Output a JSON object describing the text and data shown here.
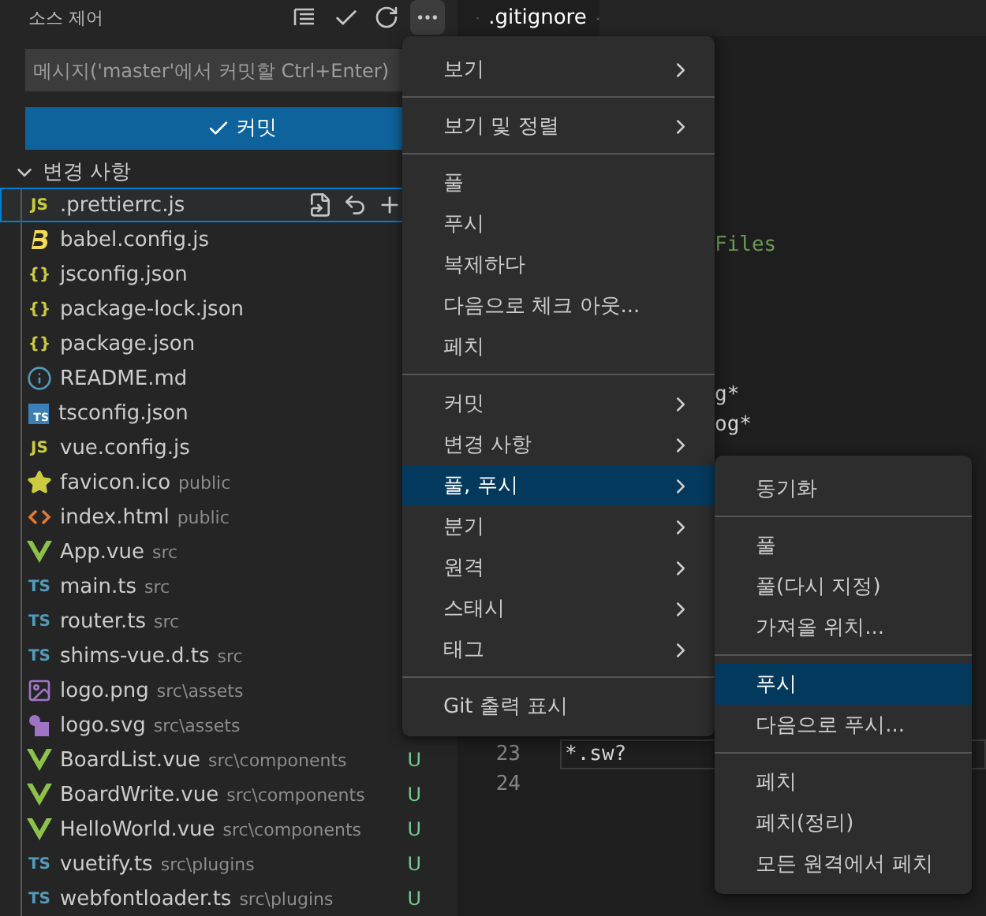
{
  "sidebar": {
    "title": "소스 제어",
    "commit_input": {
      "placeholder": "메시지('master'에서 커밋할 Ctrl+Enter)"
    },
    "commit_button": "커밋",
    "changes_header": "변경 사항",
    "files": [
      {
        "name": ".prettierrc.js",
        "kind": "js",
        "icon_label": "JS",
        "selected": true
      },
      {
        "name": "babel.config.js",
        "kind": "babel",
        "selected": false
      },
      {
        "name": "jsconfig.json",
        "kind": "json",
        "icon_label": "{}",
        "selected": false
      },
      {
        "name": "package-lock.json",
        "kind": "json",
        "icon_label": "{}",
        "selected": false
      },
      {
        "name": "package.json",
        "kind": "json",
        "icon_label": "{}",
        "selected": false
      },
      {
        "name": "README.md",
        "kind": "info",
        "selected": false
      },
      {
        "name": "tsconfig.json",
        "kind": "tsbox",
        "icon_label": "TS",
        "selected": false
      },
      {
        "name": "vue.config.js",
        "kind": "js",
        "icon_label": "JS",
        "selected": false
      },
      {
        "name": "favicon.ico",
        "folder": "public",
        "kind": "star",
        "selected": false
      },
      {
        "name": "index.html",
        "folder": "public",
        "kind": "html",
        "selected": false
      },
      {
        "name": "App.vue",
        "folder": "src",
        "kind": "vue",
        "selected": false
      },
      {
        "name": "main.ts",
        "folder": "src",
        "kind": "ts",
        "icon_label": "TS",
        "selected": false
      },
      {
        "name": "router.ts",
        "folder": "src",
        "kind": "ts",
        "icon_label": "TS",
        "selected": false
      },
      {
        "name": "shims-vue.d.ts",
        "folder": "src",
        "kind": "ts",
        "icon_label": "TS",
        "selected": false
      },
      {
        "name": "logo.png",
        "folder": "src\\assets",
        "kind": "image",
        "selected": false
      },
      {
        "name": "logo.svg",
        "folder": "src\\assets",
        "kind": "svg",
        "selected": false
      },
      {
        "name": "BoardList.vue",
        "folder": "src\\components",
        "kind": "vue",
        "status": "U",
        "selected": false
      },
      {
        "name": "BoardWrite.vue",
        "folder": "src\\components",
        "kind": "vue",
        "status": "U",
        "selected": false
      },
      {
        "name": "HelloWorld.vue",
        "folder": "src\\components",
        "kind": "vue",
        "status": "U",
        "selected": false
      },
      {
        "name": "vuetify.ts",
        "folder": "src\\plugins",
        "kind": "ts",
        "icon_label": "TS",
        "status": "U",
        "selected": false
      },
      {
        "name": "webfontloader.ts",
        "folder": "src\\plugins",
        "kind": "ts",
        "icon_label": "TS",
        "status": "U",
        "selected": false
      }
    ]
  },
  "editor": {
    "tab": {
      "label": ".gitignore"
    },
    "lines": [
      {
        "text": "Files",
        "kind": "comment"
      },
      {
        "text": "g*",
        "kind": "code"
      },
      {
        "text": "og*",
        "kind": "code"
      },
      {
        "number": "23",
        "text": "*.sw?",
        "kind": "code",
        "current": true
      },
      {
        "number": "24",
        "kind": "code",
        "current": false
      }
    ]
  },
  "menu": {
    "groups": [
      [
        {
          "label": "보기",
          "submenu": true,
          "selected": false
        }
      ],
      [
        {
          "label": "보기 및 정렬",
          "submenu": true,
          "selected": false
        }
      ],
      [
        {
          "label": "풀",
          "submenu": false,
          "selected": false
        },
        {
          "label": "푸시",
          "submenu": false,
          "selected": false
        },
        {
          "label": "복제하다",
          "submenu": false,
          "selected": false
        },
        {
          "label": "다음으로 체크 아웃...",
          "submenu": false,
          "selected": false
        },
        {
          "label": "페치",
          "submenu": false,
          "selected": false
        }
      ],
      [
        {
          "label": "커밋",
          "submenu": true,
          "selected": false
        },
        {
          "label": "변경 사항",
          "submenu": true,
          "selected": false
        },
        {
          "label": "풀, 푸시",
          "submenu": true,
          "selected": true
        },
        {
          "label": "분기",
          "submenu": true,
          "selected": false
        },
        {
          "label": "원격",
          "submenu": true,
          "selected": false
        },
        {
          "label": "스태시",
          "submenu": true,
          "selected": false
        },
        {
          "label": "태그",
          "submenu": true,
          "selected": false
        }
      ],
      [
        {
          "label": "Git 출력 표시",
          "submenu": false,
          "selected": false
        }
      ]
    ]
  },
  "submenu": {
    "groups": [
      [
        {
          "label": "동기화",
          "selected": false
        }
      ],
      [
        {
          "label": "풀",
          "selected": false
        },
        {
          "label": "풀(다시 지정)",
          "selected": false
        },
        {
          "label": "가져올 위치...",
          "selected": false
        }
      ],
      [
        {
          "label": "푸시",
          "selected": true
        },
        {
          "label": "다음으로 푸시...",
          "selected": false
        }
      ],
      [
        {
          "label": "페치",
          "selected": false
        },
        {
          "label": "페치(정리)",
          "selected": false
        },
        {
          "label": "모든 원격에서 페치",
          "selected": false
        }
      ]
    ]
  }
}
